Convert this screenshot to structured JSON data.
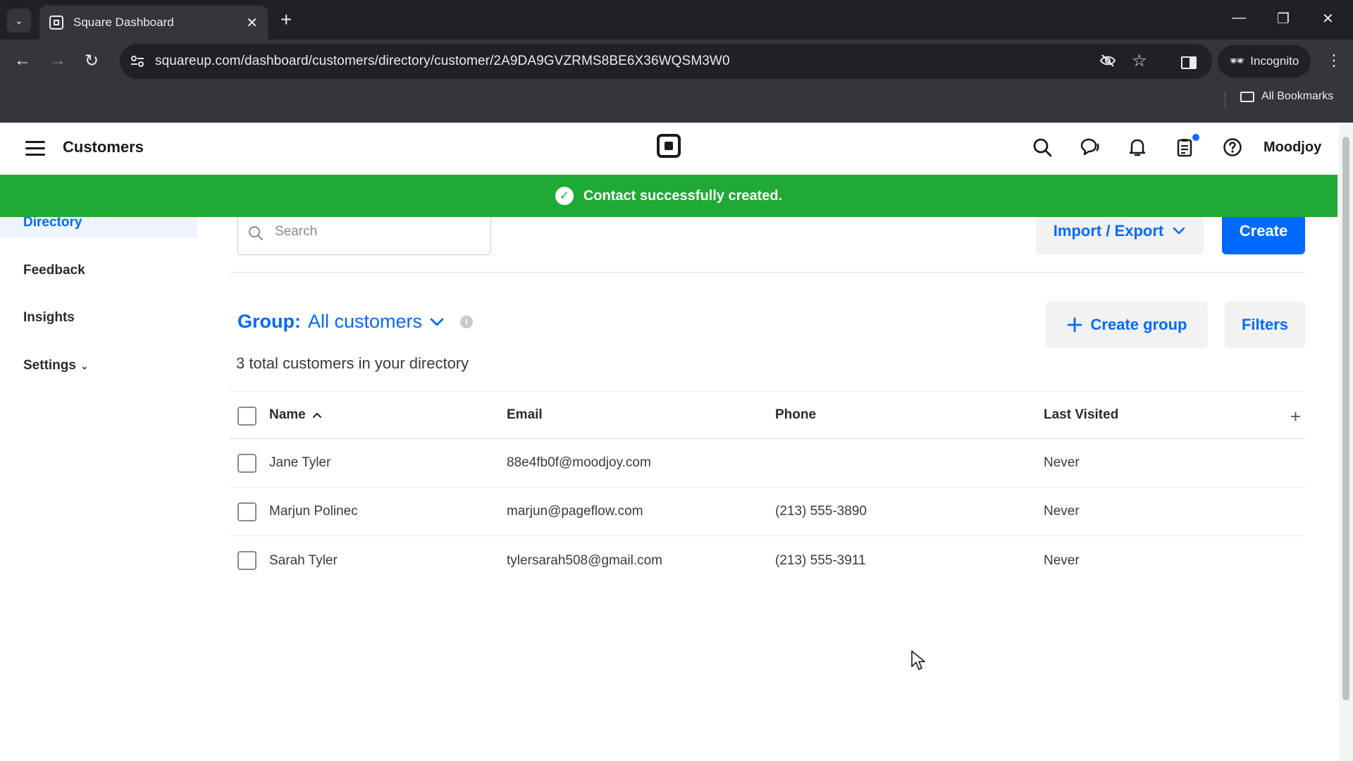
{
  "browser": {
    "tab_title": "Square Dashboard",
    "url": "squareup.com/dashboard/customers/directory/customer/2A9DA9GVZRMS8BE6X36WQSM3W0",
    "incognito_label": "Incognito",
    "bookmarks_label": "All Bookmarks"
  },
  "header": {
    "title": "Customers",
    "account_name": "Moodjoy"
  },
  "banner": {
    "message": "Contact successfully created.",
    "color": "#1faa36"
  },
  "sidebar": {
    "items": [
      {
        "label": "Directory"
      },
      {
        "label": "Feedback"
      },
      {
        "label": "Insights"
      },
      {
        "label": "Settings"
      }
    ]
  },
  "toolbar": {
    "search_placeholder": "Search",
    "import_export_label": "Import / Export",
    "create_label": "Create",
    "create_group_label": "Create group",
    "filters_label": "Filters"
  },
  "group": {
    "label": "Group:",
    "value": "All customers",
    "total_text": "3 total customers in your directory"
  },
  "table": {
    "headers": {
      "name": "Name",
      "email": "Email",
      "phone": "Phone",
      "last_visited": "Last Visited"
    },
    "rows": [
      {
        "name": "Jane Tyler",
        "email": "88e4fb0f@moodjoy.com",
        "phone": "",
        "last_visited": "Never"
      },
      {
        "name": "Marjun Polinec",
        "email": "marjun@pageflow.com",
        "phone": "(213) 555-3890",
        "last_visited": "Never"
      },
      {
        "name": "Sarah Tyler",
        "email": "tylersarah508@gmail.com",
        "phone": "(213) 555-3911",
        "last_visited": "Never"
      }
    ]
  },
  "colors": {
    "accent": "#006aff",
    "success": "#1faa36"
  }
}
